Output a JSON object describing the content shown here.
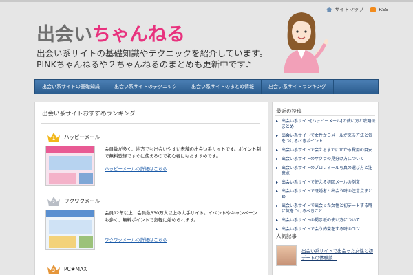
{
  "header": {
    "top_links": [
      {
        "icon": "home-icon",
        "label": "サイトマップ"
      },
      {
        "icon": "rss-icon",
        "label": "RSS"
      }
    ],
    "logo_part1": "出会い",
    "logo_part2": "ちゃんねる",
    "tagline_line1": "出会い系サイトの基礎知識やテクニックを紹介しています。",
    "tagline_line2": "PINKちゃんねるや２ちゃんねるのまとめも更新中です♪"
  },
  "nav": {
    "items": [
      "出会い系サイトの基礎知識",
      "出会い系サイトのテクニック",
      "出会い系サイトのまとめ情報",
      "出会い系サイトランキング"
    ]
  },
  "main": {
    "title": "出会い系サイトおすすめランキング",
    "entries": [
      {
        "rank": "1",
        "name": "ハッピーメール",
        "desc": "会員数が多く、地方でも出会いやすい老舗の出会い系サイトです。ポイント制で無料登録ですぐに使えるので初心者にもおすすめです。",
        "link": "ハッピーメールの詳細はこちら"
      },
      {
        "rank": "2",
        "name": "ワクワクメール",
        "desc": "会員12年以上、会員数330万人以上の大手サイト。イベントやキャンペーンも多く、無料ポイントで気軽に始められます。",
        "link": "ワクワクメールの詳細はこちら"
      },
      {
        "rank": "3",
        "name": "PC★MAX"
      }
    ]
  },
  "sidebar": {
    "recent_title": "最近の投稿",
    "recent_posts": [
      "出会い系サイト[ハッピーメール]の使い方と攻略法まとめ",
      "出会い系サイトで女性からメールが来る方法と気をつけるべきポイント",
      "出会い系サイトで会えるまでにかかる費用の目安",
      "出会い系サイトのサクラの見分け方について",
      "出会い系サイトのプロフィール写真の選び方と注意点",
      "出会い系サイトで使える初回メールの例文",
      "出会い系サイトで既婚者と出会う時の注意点まとめ",
      "出会い系サイトで出会った女性と初デートする時に気をつけるべきこと",
      "出会い系サイトの掲示板の使い方について",
      "出会い系サイトで会う約束をする時のコツ"
    ],
    "popular_title": "人気記事",
    "popular_posts": [
      "出会い系サイトで出会った女性と初デートの体験談..."
    ]
  },
  "colors": {
    "logo_gray": "#6f6f6f",
    "logo_pink": "#e8327e",
    "nav_blue": "#2c5d8f",
    "link_blue": "#1a5aa8"
  }
}
